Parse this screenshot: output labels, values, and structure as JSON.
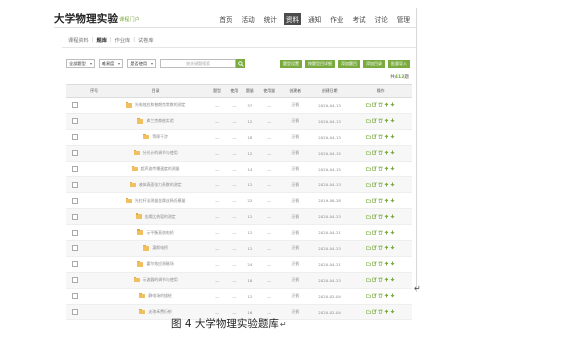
{
  "app": {
    "title": "大学物理实验",
    "subtitle": "课程门户"
  },
  "nav": {
    "items": [
      {
        "label": "首页",
        "active": false
      },
      {
        "label": "活动",
        "active": false
      },
      {
        "label": "统计",
        "active": false
      },
      {
        "label": "资料",
        "active": true
      },
      {
        "label": "通知",
        "active": false
      },
      {
        "label": "作业",
        "active": false
      },
      {
        "label": "考试",
        "active": false
      },
      {
        "label": "讨论",
        "active": false
      },
      {
        "label": "管理",
        "active": false
      }
    ]
  },
  "subtabs": [
    "课程资料",
    "题库",
    "作业库",
    "试卷库"
  ],
  "subtabs_current": "题库",
  "filters": {
    "f1": "全部题型",
    "f2": "难易度",
    "f3": "是否使用",
    "search_placeholder": "按关键题搜索"
  },
  "actions": [
    "题型设置",
    "按题型目详细",
    "添加题目",
    "添加目录",
    "批量导入"
  ],
  "total": {
    "prefix": "共",
    "count": "412",
    "suffix": "题"
  },
  "table": {
    "headers": [
      "序号",
      "目录",
      "题型",
      "使用",
      "题量",
      "使用量",
      "创建者",
      "创建日期",
      "操作"
    ],
    "rows": [
      {
        "title": "光电效应和普朗克常数的测定",
        "type": "—",
        "use": "—",
        "count": "37",
        "used": "—",
        "creator": "汪帆",
        "date": "2020-04-13"
      },
      {
        "title": "弗兰克赫兹实验",
        "type": "—",
        "use": "—",
        "count": "12",
        "used": "—",
        "creator": "汪帆",
        "date": "2020-04-13"
      },
      {
        "title": "等厚干涉",
        "type": "—",
        "use": "—",
        "count": "18",
        "used": "—",
        "creator": "汪帆",
        "date": "2020-04-13"
      },
      {
        "title": "分光计的调节与使用",
        "type": "—",
        "use": "—",
        "count": "12",
        "used": "—",
        "creator": "汪帆",
        "date": "2020-04-15"
      },
      {
        "title": "超声波传播速度的测量",
        "type": "—",
        "use": "—",
        "count": "14",
        "used": "—",
        "creator": "汪帆",
        "date": "2020-04-15"
      },
      {
        "title": "液体表面张力系数的测定",
        "type": "—",
        "use": "—",
        "count": "12",
        "used": "—",
        "creator": "汪帆",
        "date": "2020-04-13"
      },
      {
        "title": "光杠杆法测量金属丝杨氏模量",
        "type": "—",
        "use": "—",
        "count": "22",
        "used": "—",
        "creator": "汪帆",
        "date": "2019-08-28"
      },
      {
        "title": "金属比热容的测定",
        "type": "—",
        "use": "—",
        "count": "12",
        "used": "—",
        "creator": "汪帆",
        "date": "2020-04-23"
      },
      {
        "title": "示平衡直流电桥",
        "type": "—",
        "use": "—",
        "count": "12",
        "used": "—",
        "creator": "汪帆",
        "date": "2020-04-21"
      },
      {
        "title": "惠斯电桥",
        "type": "—",
        "use": "—",
        "count": "12",
        "used": "—",
        "creator": "汪帆",
        "date": "2020-04-23"
      },
      {
        "title": "霍尔效应测磁场",
        "type": "—",
        "use": "—",
        "count": "24",
        "used": "—",
        "creator": "汪帆",
        "date": "2020-04-21"
      },
      {
        "title": "示波器的调节与使用",
        "type": "—",
        "use": "—",
        "count": "18",
        "used": "—",
        "creator": "汪帆",
        "date": "2020-04-23"
      },
      {
        "title": "静电场的描绘",
        "type": "—",
        "use": "—",
        "count": "12",
        "used": "—",
        "creator": "汪帆",
        "date": "2020-02-04"
      },
      {
        "title": "夫琅禾费衍射",
        "type": "—",
        "use": "—",
        "count": "16",
        "used": "—",
        "creator": "汪帆",
        "date": "2020-02-04"
      }
    ]
  },
  "caption": "图 4  大学物理实验题库",
  "marks": {
    "return": "↵"
  },
  "colors": {
    "accent": "#7aab3f",
    "nav_active": "#4c4c4c",
    "folder": "#f0c060"
  },
  "icons": [
    "search-icon",
    "folder-icon",
    "move-icon",
    "edit-icon",
    "delete-icon",
    "move-up-icon",
    "move-down-icon"
  ]
}
